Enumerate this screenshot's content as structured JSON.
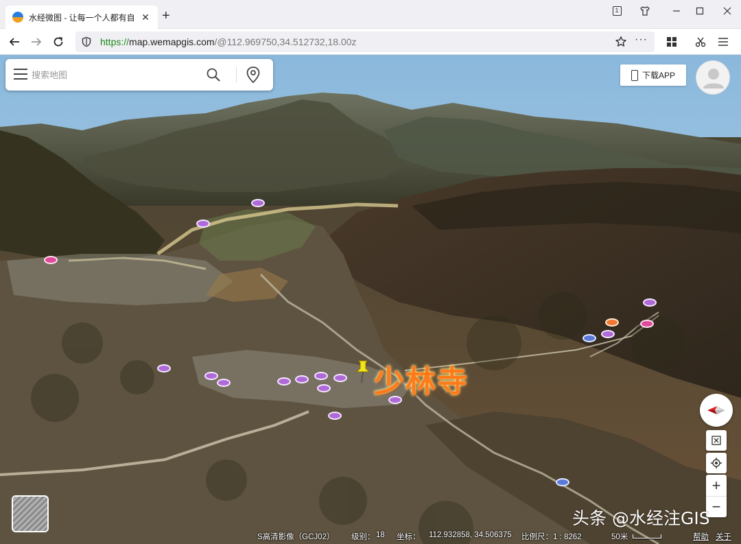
{
  "browser": {
    "tab_title": "水经微图 - 让每一个人都有自",
    "tab_count": "1",
    "url_scheme": "https://",
    "url_host": "map.wemapgis.com",
    "url_path": "/@112.969750,34.512732,18.00z"
  },
  "search": {
    "placeholder": "搜索地图"
  },
  "header": {
    "download_app": "下载APP"
  },
  "map": {
    "place_label": "少林寺",
    "watermark": "头条 @水经注GIS"
  },
  "status": {
    "imagery": "S高清影像（GCJ02）",
    "level_label": "级别：",
    "level_value": "18",
    "coord_label": "坐标：",
    "coord_value": "112.932858, 34.506375",
    "scale_label": "比例尺：1 : 8262",
    "scale_distance": "50米",
    "help": "帮助",
    "about": "关于"
  },
  "colors": {
    "place_label": "#ff7a1a",
    "url_scheme": "#1a8a1a",
    "poi": "#b06ad8"
  }
}
